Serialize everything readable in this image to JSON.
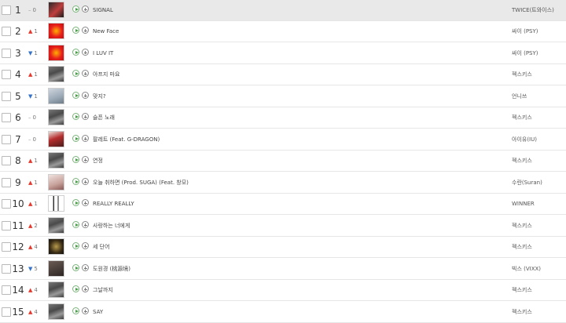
{
  "chart": {
    "rows": [
      {
        "rank": "1",
        "arrow": "–",
        "arrow_type": "same",
        "change": "0",
        "title": "SIGNAL",
        "artist": "TWICE(트와이스)",
        "thumb": "t-twice",
        "highlight": true
      },
      {
        "rank": "2",
        "arrow": "▲",
        "arrow_type": "up",
        "change": "1",
        "title": "New Face",
        "artist": "싸이 (PSY)",
        "thumb": "t-psy",
        "highlight": false
      },
      {
        "rank": "3",
        "arrow": "▼",
        "arrow_type": "down",
        "change": "1",
        "title": "I LUV IT",
        "artist": "싸이 (PSY)",
        "thumb": "t-psy",
        "highlight": false
      },
      {
        "rank": "4",
        "arrow": "▲",
        "arrow_type": "up",
        "change": "1",
        "title": "아프지 마요",
        "artist": "젝스키스",
        "thumb": "t-gray",
        "highlight": false
      },
      {
        "rank": "5",
        "arrow": "▼",
        "arrow_type": "down",
        "change": "1",
        "title": "맞지?",
        "artist": "언니쓰",
        "thumb": "t-light",
        "highlight": false
      },
      {
        "rank": "6",
        "arrow": "–",
        "arrow_type": "same",
        "change": "0",
        "title": "슬픈 노래",
        "artist": "젝스키스",
        "thumb": "t-gray",
        "highlight": false
      },
      {
        "rank": "7",
        "arrow": "–",
        "arrow_type": "same",
        "change": "0",
        "title": "팔레트 (Feat. G-DRAGON)",
        "artist": "아이유(IU)",
        "thumb": "t-red",
        "highlight": false
      },
      {
        "rank": "8",
        "arrow": "▲",
        "arrow_type": "up",
        "change": "1",
        "title": "연정",
        "artist": "젝스키스",
        "thumb": "t-gray",
        "highlight": false
      },
      {
        "rank": "9",
        "arrow": "▲",
        "arrow_type": "up",
        "change": "1",
        "title": "오늘 취하면 (Prod. SUGA) (Feat. 창모)",
        "artist": "수란(Suran)",
        "thumb": "t-rose",
        "highlight": false
      },
      {
        "rank": "10",
        "arrow": "▲",
        "arrow_type": "up",
        "change": "1",
        "title": "REALLY REALLY",
        "artist": "WINNER",
        "thumb": "t-bw",
        "highlight": false
      },
      {
        "rank": "11",
        "arrow": "▲",
        "arrow_type": "up",
        "change": "2",
        "title": "사랑하는 너에게",
        "artist": "젝스키스",
        "thumb": "t-gray",
        "highlight": false
      },
      {
        "rank": "12",
        "arrow": "▲",
        "arrow_type": "up",
        "change": "4",
        "title": "세 단어",
        "artist": "젝스키스",
        "thumb": "t-gold",
        "highlight": false
      },
      {
        "rank": "13",
        "arrow": "▼",
        "arrow_type": "down",
        "change": "5",
        "title": "도원경 (桃源境)",
        "artist": "빅스 (VIXX)",
        "thumb": "t-vixx",
        "highlight": false
      },
      {
        "rank": "14",
        "arrow": "▲",
        "arrow_type": "up",
        "change": "4",
        "title": "그날까지",
        "artist": "젝스키스",
        "thumb": "t-gray",
        "highlight": false
      },
      {
        "rank": "15",
        "arrow": "▲",
        "arrow_type": "up",
        "change": "4",
        "title": "SAY",
        "artist": "젝스키스",
        "thumb": "t-gray",
        "highlight": false
      }
    ]
  }
}
